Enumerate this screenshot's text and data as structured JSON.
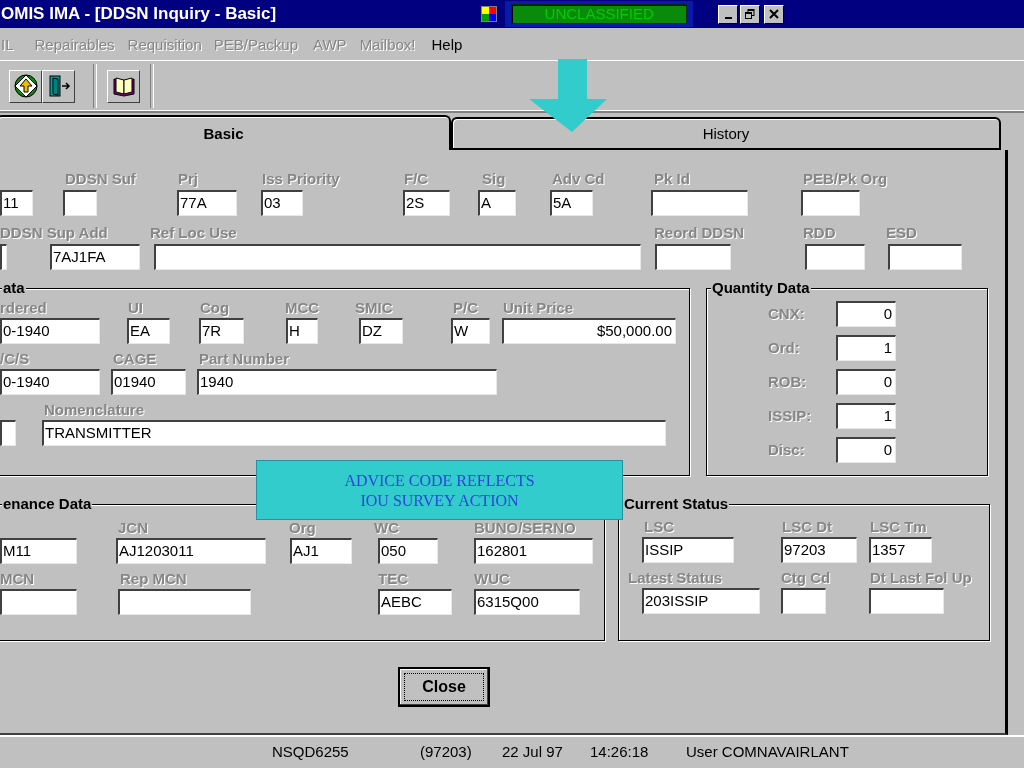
{
  "window": {
    "title": "OMIS IMA - [DDSN Inquiry - Basic]",
    "classification": "UNCLASSIFIED"
  },
  "menu": [
    {
      "label": "IL",
      "disabled": true
    },
    {
      "label": "Repairables",
      "disabled": true
    },
    {
      "label": "Requisition",
      "disabled": true
    },
    {
      "label": "PEB/Packup",
      "disabled": true
    },
    {
      "label": "AWP",
      "disabled": true
    },
    {
      "label": "Mailbox!",
      "disabled": true
    },
    {
      "label": "Help",
      "disabled": false
    }
  ],
  "tabs": [
    {
      "label": "Basic",
      "selected": true
    },
    {
      "label": "History",
      "selected": false
    }
  ],
  "header_rows": [
    {
      "labels": [
        "DDSN Suf",
        "Prj",
        "Iss Priority",
        "F/C",
        "Sig",
        "Adv Cd",
        "Pk Id",
        "PEB/Pk Org"
      ],
      "fields": [
        "11",
        "77A",
        "03",
        "2S",
        "A",
        "5A"
      ]
    },
    {
      "labels": [
        "DDSN Sup Add",
        "Ref Loc Use",
        "Reord DDSN",
        "RDD",
        "ESD"
      ],
      "fields": [
        "7AJ1FA"
      ]
    }
  ],
  "item_data": {
    "title": "ata",
    "rows": [
      {
        "labels": [
          "rdered",
          "UI",
          "Cog",
          "MCC",
          "SMIC",
          "P/C",
          "Unit Price"
        ],
        "fields": [
          "0-1940",
          "EA",
          "7R",
          "H",
          "DZ",
          "W",
          "$50,000.00"
        ]
      },
      {
        "labels": [
          "/C/S",
          "CAGE",
          "Part Number"
        ],
        "fields": [
          "0-1940",
          "01940",
          "1940"
        ]
      },
      {
        "labels": [
          "Nomenclature"
        ],
        "fields": [
          "TRANSMITTER"
        ]
      }
    ]
  },
  "quantity_data": {
    "title": "Quantity Data",
    "rows": [
      {
        "label": "CNX:",
        "value": "0"
      },
      {
        "label": "Ord:",
        "value": "1"
      },
      {
        "label": "ROB:",
        "value": "0"
      },
      {
        "label": "ISSIP:",
        "value": "1"
      },
      {
        "label": "Disc:",
        "value": "0"
      }
    ]
  },
  "maintenance_data": {
    "title": "enance Data",
    "rows": [
      {
        "labels": [
          "JCN",
          "Org",
          "WC",
          "BUNO/SERNO"
        ],
        "fields": [
          "M11",
          "AJ1203011",
          "AJ1",
          "050",
          "162801"
        ]
      },
      {
        "labels": [
          "MCN",
          "Rep MCN",
          "TEC",
          "WUC"
        ],
        "fields": [
          "AEBC",
          "6315Q00"
        ]
      }
    ]
  },
  "current_status": {
    "title": "Current Status",
    "rows": [
      {
        "labels": [
          "LSC",
          "LSC Dt",
          "LSC Tm"
        ],
        "fields": [
          "ISSIP",
          "97203",
          "1357"
        ]
      },
      {
        "labels": [
          "Latest Status",
          "Ctg Cd",
          "Dt Last Fol Up"
        ],
        "fields": [
          "203ISSIP"
        ]
      }
    ]
  },
  "close_button": "Close",
  "callout": {
    "lines": [
      "ADVICE CODE REFLECTS",
      "IOU SURVEY ACTION"
    ]
  },
  "status_bar": [
    "NSQD6255",
    "(97203)",
    "22 Jul 97",
    "14:26:18",
    "User COMNAVAIRLANT"
  ]
}
